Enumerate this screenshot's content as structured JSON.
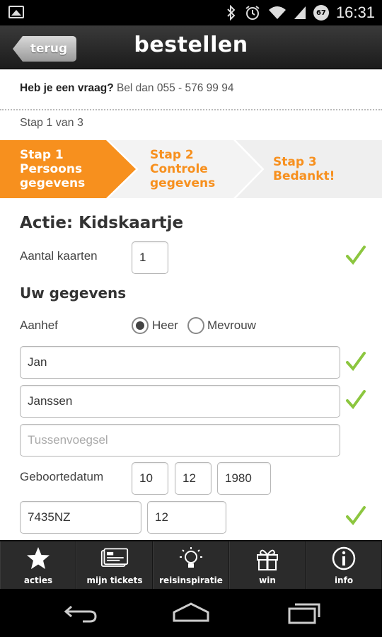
{
  "status_bar": {
    "time": "16:31",
    "battery_level": "67",
    "icons": [
      "picture-icon",
      "bluetooth-icon",
      "alarm-icon",
      "wifi-icon",
      "signal-icon",
      "battery-icon"
    ]
  },
  "header": {
    "back_label": "terug",
    "title": "bestellen"
  },
  "question": {
    "bold": "Heb je een vraag?",
    "rest": " Bel dan 055 - 576 99 94"
  },
  "step_counter": "Stap 1 van 3",
  "steps": [
    {
      "line1": "Stap 1",
      "line2": "Persoons",
      "line3": "gegevens"
    },
    {
      "line1": "Stap 2",
      "line2": "Controle",
      "line3": "gegevens"
    },
    {
      "line1": "Stap 3",
      "line2": "Bedankt!"
    }
  ],
  "form": {
    "action_title": "Actie: Kidskaartje",
    "aantal_label": "Aantal kaarten",
    "aantal_value": "1",
    "uw_gegevens_title": "Uw gegevens",
    "aanhef_label": "Aanhef",
    "aanhef_options": [
      "Heer",
      "Mevrouw"
    ],
    "aanhef_selected": "Heer",
    "first_name": "Jan",
    "last_name": "Janssen",
    "tussenvoegsel_placeholder": "Tussenvoegsel",
    "geboortedatum_label": "Geboortedatum",
    "birth_day": "10",
    "birth_month": "12",
    "birth_year": "1980",
    "postcode": "7435NZ",
    "house_number": "12"
  },
  "tabs": [
    {
      "label": "acties",
      "icon": "star-icon"
    },
    {
      "label": "mijn tickets",
      "icon": "ticket-icon"
    },
    {
      "label": "reisinspiratie",
      "icon": "lightbulb-icon"
    },
    {
      "label": "win",
      "icon": "gift-icon"
    },
    {
      "label": "info",
      "icon": "info-icon"
    }
  ],
  "colors": {
    "accent": "#f7901e",
    "check": "#8cc63f",
    "header": "#2a2a2a"
  }
}
